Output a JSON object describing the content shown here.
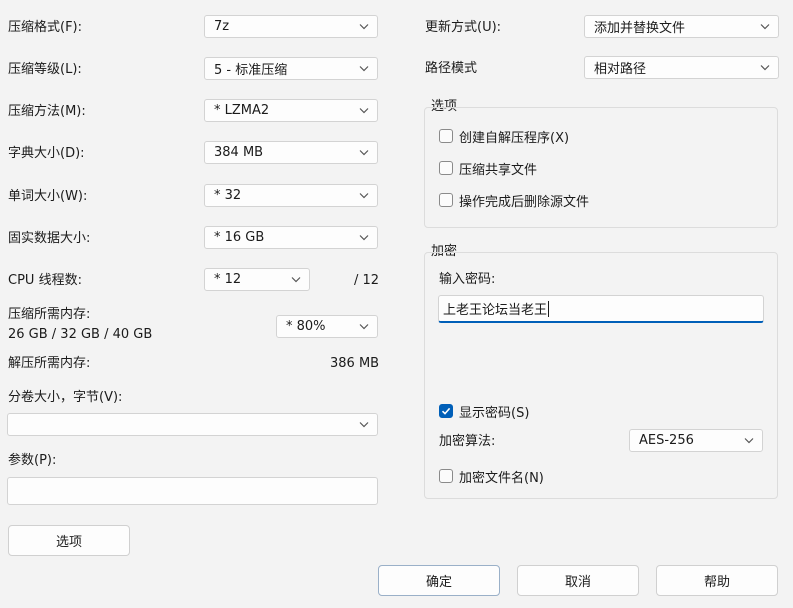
{
  "left": {
    "format": {
      "label": "压缩格式(F):",
      "value": "7z"
    },
    "level": {
      "label": "压缩等级(L):",
      "value": "5 - 标准压缩"
    },
    "method": {
      "label": "压缩方法(M):",
      "value": "*  LZMA2"
    },
    "dict": {
      "label": "字典大小(D):",
      "value": "384 MB"
    },
    "word": {
      "label": "单词大小(W):",
      "value": "*  32"
    },
    "solid": {
      "label": "固实数据大小:",
      "value": "*  16 GB"
    },
    "cpu": {
      "label": "CPU 线程数:",
      "value": "*  12",
      "total": "/ 12"
    },
    "mem_comp": {
      "label": "压缩所需内存:",
      "detail": "26 GB / 32 GB / 40 GB",
      "value": "*  80%"
    },
    "mem_decomp": {
      "label": "解压所需内存:",
      "value": "386 MB"
    },
    "split": {
      "label": "分卷大小，字节(V):",
      "value": ""
    },
    "params": {
      "label": "参数(P):",
      "value": ""
    },
    "options_button": "选项"
  },
  "right": {
    "update": {
      "label": "更新方式(U):",
      "value": "添加并替换文件"
    },
    "path": {
      "label": "路径模式",
      "value": "相对路径"
    },
    "options_group": {
      "title": "选项",
      "items": [
        {
          "label": "创建自解压程序(X)",
          "checked": false
        },
        {
          "label": "压缩共享文件",
          "checked": false
        },
        {
          "label": "操作完成后删除源文件",
          "checked": false
        }
      ]
    },
    "encryption": {
      "title": "加密",
      "password_label": "输入密码:",
      "password_value": "上老王论坛当老王",
      "show_password": {
        "label": "显示密码(S)",
        "checked": true
      },
      "algo_label": "加密算法:",
      "algo_value": "AES-256",
      "encrypt_names": {
        "label": "加密文件名(N)",
        "checked": false
      }
    }
  },
  "buttons": {
    "ok": "确定",
    "cancel": "取消",
    "help": "帮助"
  },
  "colors": {
    "accent": "#005fb8",
    "background": "#f3f3f3"
  }
}
